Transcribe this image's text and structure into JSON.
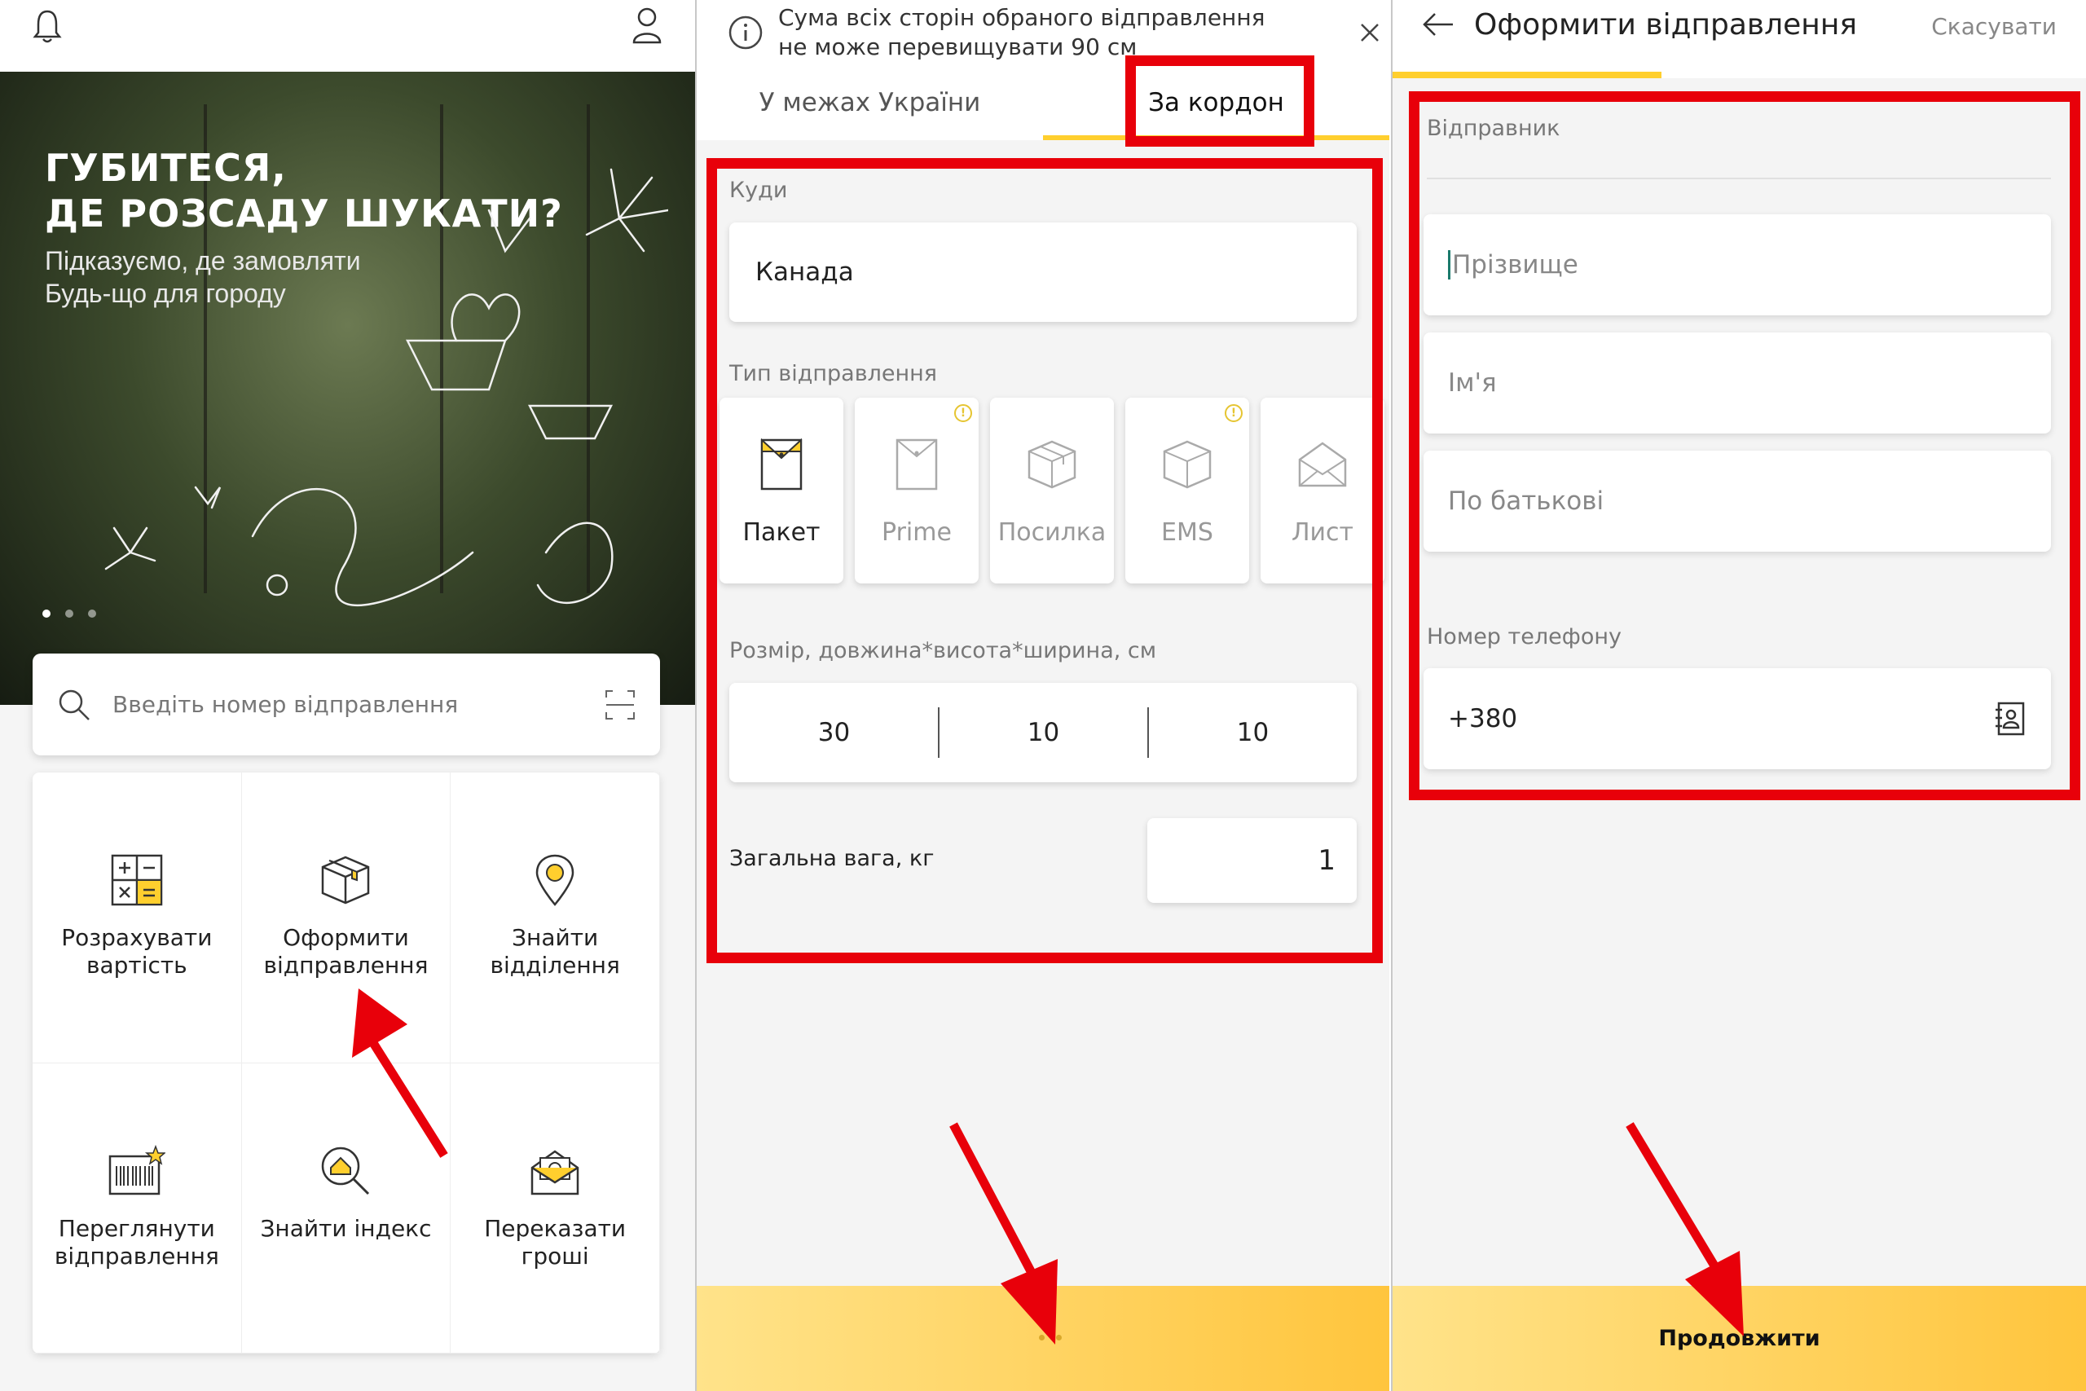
{
  "screen1": {
    "banner": {
      "title_line1": "ГУБИТЕСЯ,",
      "title_line2": "ДЕ РОЗСАДУ ШУКАТИ?",
      "subtitle_line1": "Підказуємо, де замовляти",
      "subtitle_line2": "Будь-що для городу"
    },
    "search": {
      "placeholder": "Введіть номер відправлення"
    },
    "tiles": [
      {
        "label": "Розрахувати вартість",
        "icon": "calculator-icon"
      },
      {
        "label": "Оформити відправлення",
        "icon": "box-icon"
      },
      {
        "label": "Знайти відділення",
        "icon": "location-pin-icon"
      },
      {
        "label": "Переглянути відправлення",
        "icon": "barcode-icon"
      },
      {
        "label": "Знайти індекс",
        "icon": "search-house-icon"
      },
      {
        "label": "Переказати гроші",
        "icon": "envelope-money-icon"
      }
    ]
  },
  "screen2": {
    "info": "Сума всіх сторін обраного відправлення не може перевищувати 90 см",
    "tabs": [
      "У межах України",
      "За кордон"
    ],
    "destination_label": "Куди",
    "destination_value": "Канада",
    "type_label": "Тип відправлення",
    "types": [
      "Пакет",
      "Prime",
      "Посилка",
      "EMS",
      "Лист"
    ],
    "size_label": "Розмір, довжина*висота*ширина, см",
    "size_values": [
      "30",
      "10",
      "10"
    ],
    "weight_label": "Загальна вага, кг",
    "weight_value": "1"
  },
  "screen3": {
    "title": "Оформити відправлення",
    "cancel": "Скасувати",
    "sender_label": "Відправник",
    "fields": [
      "Прізвище",
      "Ім'я",
      "По батькові"
    ],
    "phone_label": "Номер телефону",
    "phone_value": "+380",
    "continue": "Продовжити"
  },
  "colors": {
    "accent": "#ffcf2e",
    "annotation": "#e8000a",
    "warning": "#e6c532"
  }
}
